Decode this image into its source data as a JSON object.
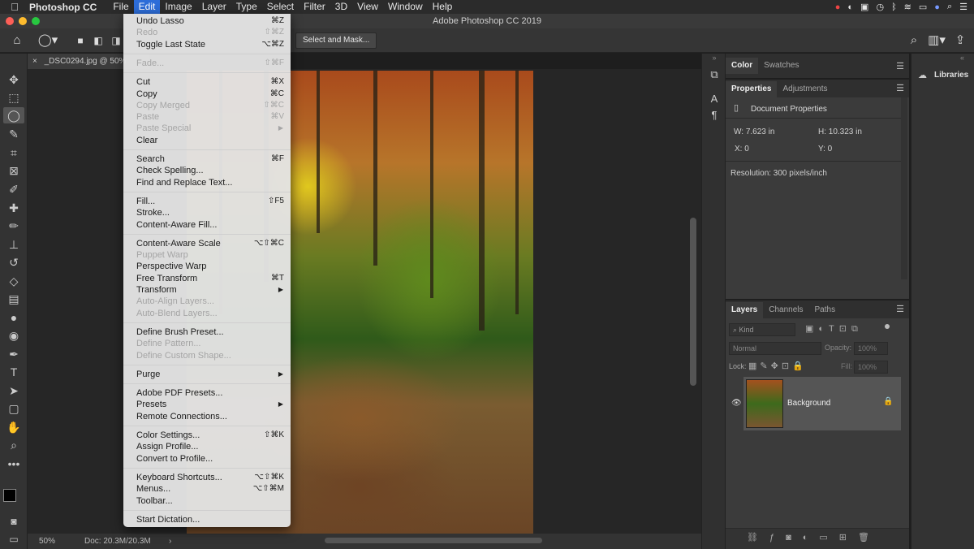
{
  "menubar": {
    "app_name": "Photoshop CC",
    "items": [
      "File",
      "Edit",
      "Image",
      "Layer",
      "Type",
      "Select",
      "Filter",
      "3D",
      "View",
      "Window",
      "Help"
    ],
    "active_item": "Edit"
  },
  "window": {
    "title": "Adobe Photoshop CC 2019"
  },
  "options": {
    "select_and_mask": "Select and Mask..."
  },
  "document": {
    "tab_title": "_DSC0294.jpg @ 50%",
    "zoom": "50%",
    "doc_size": "Doc: 20.3M/20.3M"
  },
  "edit_menu": {
    "groups": [
      [
        {
          "label": "Undo Lasso",
          "shortcut": "⌘Z",
          "disabled": false
        },
        {
          "label": "Redo",
          "shortcut": "⇧⌘Z",
          "disabled": true
        },
        {
          "label": "Toggle Last State",
          "shortcut": "⌥⌘Z",
          "disabled": false
        }
      ],
      [
        {
          "label": "Fade...",
          "shortcut": "⇧⌘F",
          "disabled": true
        }
      ],
      [
        {
          "label": "Cut",
          "shortcut": "⌘X",
          "disabled": false
        },
        {
          "label": "Copy",
          "shortcut": "⌘C",
          "disabled": false
        },
        {
          "label": "Copy Merged",
          "shortcut": "⇧⌘C",
          "disabled": true
        },
        {
          "label": "Paste",
          "shortcut": "⌘V",
          "disabled": true
        },
        {
          "label": "Paste Special",
          "shortcut": "",
          "disabled": true,
          "submenu": true
        },
        {
          "label": "Clear",
          "shortcut": "",
          "disabled": false
        }
      ],
      [
        {
          "label": "Search",
          "shortcut": "⌘F",
          "disabled": false
        },
        {
          "label": "Check Spelling...",
          "shortcut": "",
          "disabled": false
        },
        {
          "label": "Find and Replace Text...",
          "shortcut": "",
          "disabled": false
        }
      ],
      [
        {
          "label": "Fill...",
          "shortcut": "⇧F5",
          "disabled": false
        },
        {
          "label": "Stroke...",
          "shortcut": "",
          "disabled": false
        },
        {
          "label": "Content-Aware Fill...",
          "shortcut": "",
          "disabled": false
        }
      ],
      [
        {
          "label": "Content-Aware Scale",
          "shortcut": "⌥⇧⌘C",
          "disabled": false
        },
        {
          "label": "Puppet Warp",
          "shortcut": "",
          "disabled": true
        },
        {
          "label": "Perspective Warp",
          "shortcut": "",
          "disabled": false
        },
        {
          "label": "Free Transform",
          "shortcut": "⌘T",
          "disabled": false
        },
        {
          "label": "Transform",
          "shortcut": "",
          "disabled": false,
          "submenu": true
        },
        {
          "label": "Auto-Align Layers...",
          "shortcut": "",
          "disabled": true
        },
        {
          "label": "Auto-Blend Layers...",
          "shortcut": "",
          "disabled": true
        }
      ],
      [
        {
          "label": "Define Brush Preset...",
          "shortcut": "",
          "disabled": false
        },
        {
          "label": "Define Pattern...",
          "shortcut": "",
          "disabled": true
        },
        {
          "label": "Define Custom Shape...",
          "shortcut": "",
          "disabled": true
        }
      ],
      [
        {
          "label": "Purge",
          "shortcut": "",
          "disabled": false,
          "submenu": true
        }
      ],
      [
        {
          "label": "Adobe PDF Presets...",
          "shortcut": "",
          "disabled": false
        },
        {
          "label": "Presets",
          "shortcut": "",
          "disabled": false,
          "submenu": true
        },
        {
          "label": "Remote Connections...",
          "shortcut": "",
          "disabled": false
        }
      ],
      [
        {
          "label": "Color Settings...",
          "shortcut": "⇧⌘K",
          "disabled": false
        },
        {
          "label": "Assign Profile...",
          "shortcut": "",
          "disabled": false
        },
        {
          "label": "Convert to Profile...",
          "shortcut": "",
          "disabled": false
        }
      ],
      [
        {
          "label": "Keyboard Shortcuts...",
          "shortcut": "⌥⇧⌘K",
          "disabled": false
        },
        {
          "label": "Menus...",
          "shortcut": "⌥⇧⌘M",
          "disabled": false
        },
        {
          "label": "Toolbar...",
          "shortcut": "",
          "disabled": false
        }
      ],
      [
        {
          "label": "Start Dictation...",
          "shortcut": "",
          "disabled": false
        }
      ]
    ]
  },
  "color_panel": {
    "tabs": [
      "Color",
      "Swatches"
    ]
  },
  "properties_panel": {
    "tabs": [
      "Properties",
      "Adjustments"
    ],
    "section": "Document Properties",
    "w": "W: 7.623 in",
    "h": "H: 10.323 in",
    "x": "X: 0",
    "y": "Y: 0",
    "resolution": "Resolution: 300 pixels/inch"
  },
  "layers_panel": {
    "tabs": [
      "Layers",
      "Channels",
      "Paths"
    ],
    "filter_placeholder": "Kind",
    "blend_mode": "Normal",
    "opacity_label": "Opacity:",
    "opacity_value": "100%",
    "lock_label": "Lock:",
    "fill_label": "Fill:",
    "fill_value": "100%",
    "layer_name": "Background"
  },
  "libraries": {
    "label": "Libraries"
  },
  "colors": {
    "menu_highlight": "#2d6dd8",
    "panel_bg": "#3b3b3b",
    "app_bg": "#1e1e1e"
  }
}
